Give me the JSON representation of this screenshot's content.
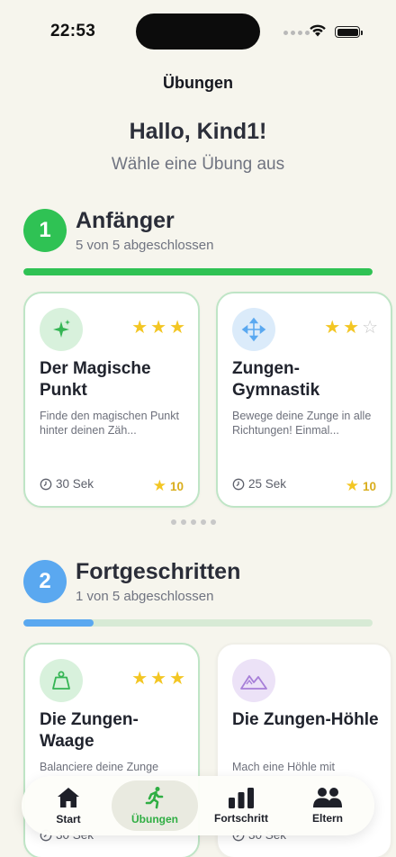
{
  "status_bar": {
    "time": "22:53"
  },
  "nav": {
    "title": "Übungen"
  },
  "header": {
    "greeting": "Hallo, Kind1!",
    "subtitle": "Wähle eine Übung aus"
  },
  "levels": [
    {
      "number": "1",
      "title": "Anfänger",
      "progress_text": "5 von 5 abgeschlossen",
      "progress": 1.0,
      "color": "#2fc254",
      "cards": [
        {
          "title": "Der Magische Punkt",
          "description": "Finde den magischen Punkt hinter deinen Zäh...",
          "stars": 3,
          "duration": "30 Sek",
          "points": "10",
          "icon": "sparkles-icon"
        },
        {
          "title": "Zungen-Gymnastik",
          "description": "Bewege deine Zunge in alle Richtungen! Einmal...",
          "stars": 2,
          "duration": "25 Sek",
          "points": "10",
          "icon": "move-arrows-icon"
        }
      ]
    },
    {
      "number": "2",
      "title": "Fortgeschritten",
      "progress_text": "1 von 5 abgeschlossen",
      "progress": 0.2,
      "color": "#5aa8f0",
      "cards": [
        {
          "title": "Die Zungen-Waage",
          "description": "Balanciere deine Zunge",
          "stars": 3,
          "duration": "30 Sek",
          "icon": "scale-weight-icon"
        },
        {
          "title": "Die Zungen-Höhle",
          "description": "Mach eine Höhle mit",
          "stars": 0,
          "duration": "30 Sek",
          "icon": "mountain-icon"
        }
      ]
    }
  ],
  "tab_bar": {
    "items": [
      {
        "label": "Start",
        "icon": "home-icon",
        "active": false
      },
      {
        "label": "Übungen",
        "icon": "running-person-icon",
        "active": true
      },
      {
        "label": "Fortschritt",
        "icon": "bar-chart-icon",
        "active": false
      },
      {
        "label": "Eltern",
        "icon": "parents-icon",
        "active": false
      }
    ]
  },
  "colors": {
    "background": "#f6f5ed",
    "accent_green": "#2fc254",
    "accent_blue": "#5aa8f0",
    "star": "#f3c623",
    "active_tab": "#2fae43"
  }
}
